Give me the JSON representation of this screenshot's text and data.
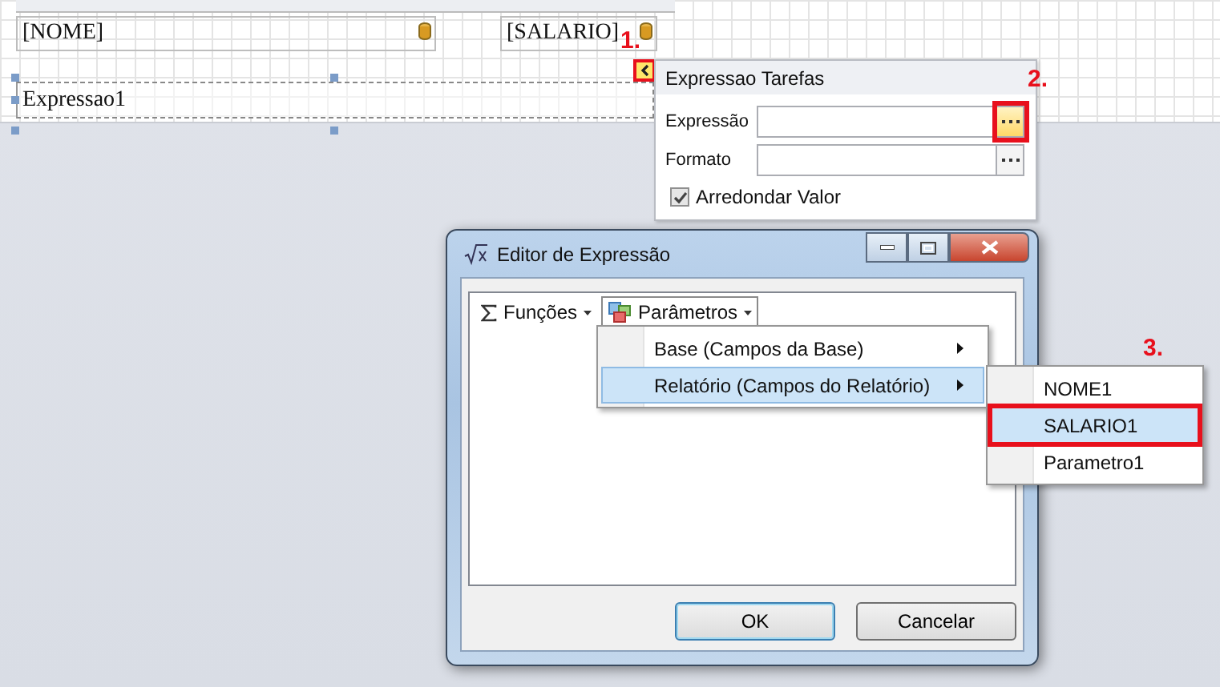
{
  "designer": {
    "band_fields": [
      {
        "text": "[NOME]"
      },
      {
        "text": "[SALARIO]"
      }
    ],
    "expression_field": "Expressao1"
  },
  "steps": [
    "1.",
    "2.",
    "3."
  ],
  "tasks_panel": {
    "title": "Expressao Tarefas",
    "fields": [
      {
        "label": "Expressão",
        "highlighted": true
      },
      {
        "label": "Formato",
        "highlighted": false
      }
    ],
    "checkbox": {
      "label": "Arredondar Valor",
      "checked": true
    }
  },
  "dialog": {
    "title": "Editor de Expressão",
    "toolbar": [
      {
        "label": "Funções",
        "selected": false
      },
      {
        "label": "Parâmetros",
        "selected": true
      }
    ],
    "menu": [
      {
        "label": "Base (Campos da Base)",
        "selected": false
      },
      {
        "label": "Relatório (Campos do Relatório)",
        "selected": true
      }
    ],
    "submenu": [
      {
        "label": "NOME1",
        "selected": false
      },
      {
        "label": "SALARIO1",
        "selected": true
      },
      {
        "label": "Parametro1",
        "selected": false
      }
    ],
    "buttons": [
      {
        "label": "OK",
        "default": true
      },
      {
        "label": "Cancelar",
        "default": false
      }
    ]
  }
}
